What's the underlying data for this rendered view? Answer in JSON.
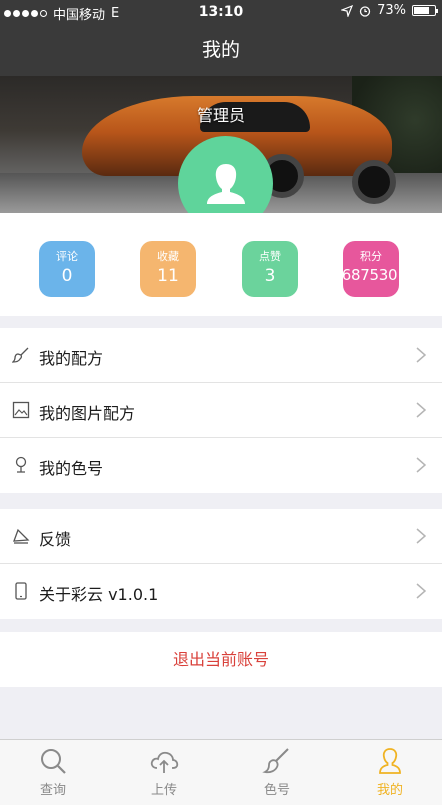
{
  "status_bar": {
    "carrier": "中国移动",
    "network": "E",
    "time": "13:10",
    "battery": "73%",
    "battery_level": 0.73
  },
  "nav": {
    "title": "我的"
  },
  "profile": {
    "name": "管理员"
  },
  "stats": [
    {
      "label": "评论",
      "value": "0",
      "color": "#6bb4ea"
    },
    {
      "label": "收藏",
      "value": "11",
      "color": "#f5b66f"
    },
    {
      "label": "点赞",
      "value": "3",
      "color": "#6bd39c"
    },
    {
      "label": "积分",
      "value": "687530",
      "color": "#e7579c"
    }
  ],
  "menu_group_1": [
    {
      "label": "我的配方",
      "icon": "brush-icon"
    },
    {
      "label": "我的图片配方",
      "icon": "image-icon"
    },
    {
      "label": "我的色号",
      "icon": "color-picker-icon"
    }
  ],
  "menu_group_2": [
    {
      "label": "反馈",
      "icon": "feedback-icon"
    },
    {
      "label": "关于彩云 v1.0.1",
      "icon": "phone-icon"
    }
  ],
  "logout": {
    "label": "退出当前账号",
    "color": "#d9403a"
  },
  "tabbar": [
    {
      "label": "查询",
      "icon": "search-icon",
      "active": false
    },
    {
      "label": "上传",
      "icon": "cloud-upload-icon",
      "active": false
    },
    {
      "label": "色号",
      "icon": "brush-icon",
      "active": false
    },
    {
      "label": "我的",
      "icon": "user-icon",
      "active": true
    }
  ],
  "accent_color": "#f0b323"
}
